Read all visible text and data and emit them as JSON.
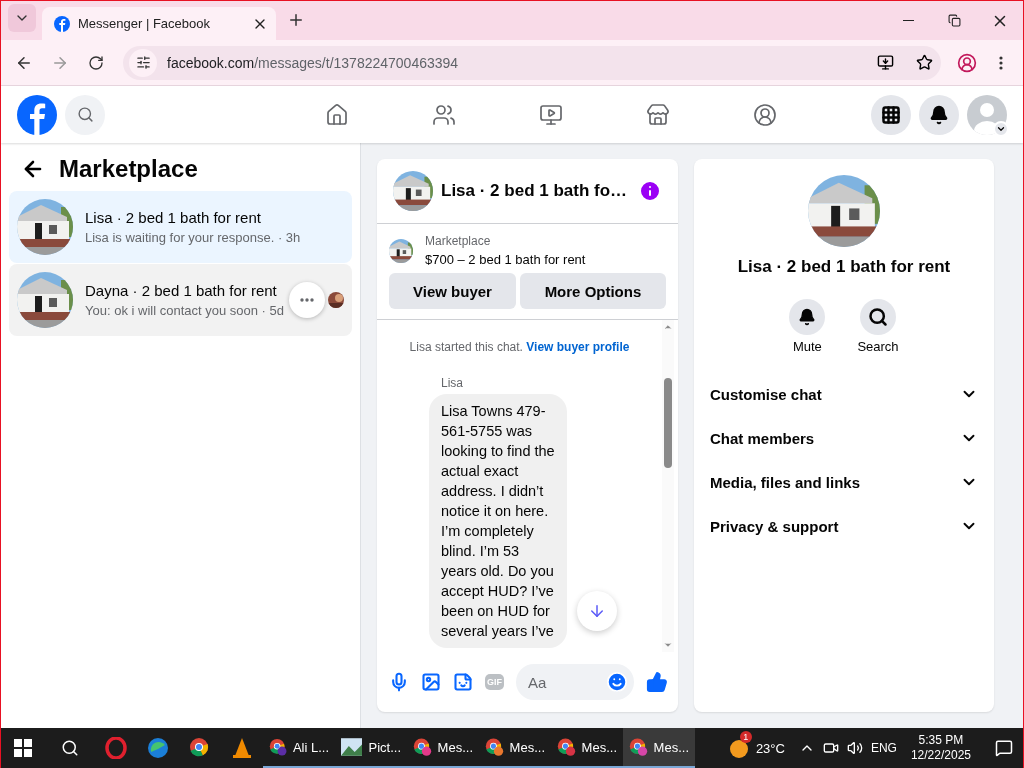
{
  "browser": {
    "tab_title": "Messenger | Facebook",
    "url_host": "facebook.com",
    "url_path": "/messages/t/1378224700463394"
  },
  "left_panel": {
    "title": "Marketplace",
    "conversations": [
      {
        "name": "Lisa · 2 bed 1 bath for rent",
        "meta": "Lisa is waiting for your response. · 3h",
        "selected": true,
        "hovered": false,
        "read_avatar": false
      },
      {
        "name": "Dayna · 2 bed 1 bath for rent",
        "meta": "You: ok i will contact you soon · 5d",
        "selected": false,
        "hovered": true,
        "read_avatar": true
      }
    ]
  },
  "chat": {
    "title": "Lisa · 2 bed 1 bath fo…",
    "listing_source": "Marketplace",
    "listing_title": "$700 – 2 bed 1 bath for rent",
    "buttons": [
      "View buyer",
      "More Options"
    ],
    "system_note": "Lisa started this chat.",
    "system_link": "View buyer profile",
    "sender": "Lisa",
    "message": "Lisa Towns 479-561-5755 was looking to find the actual exact address. I didn’t notice it on here. I’m completely blind. I’m 53 years old. Do you accept HUD? I’ve been on HUD for several years I’ve",
    "composer": {
      "placeholder": "Aa",
      "gif_label": "GIF"
    }
  },
  "info": {
    "title": "Lisa · 2 bed 1 bath for rent",
    "actions": [
      {
        "kind": "bell",
        "label": "Mute"
      },
      {
        "kind": "search",
        "label": "Search"
      }
    ],
    "sections": [
      {
        "label": "Customise chat",
        "expanded": false
      },
      {
        "label": "Chat members",
        "expanded": false
      },
      {
        "label": "Media, files and links",
        "expanded": false
      },
      {
        "label": "Privacy & support",
        "expanded": false
      }
    ]
  },
  "taskbar": {
    "apps": [
      {
        "kind": "opera"
      },
      {
        "kind": "edge"
      },
      {
        "kind": "chrome"
      },
      {
        "kind": "vlc"
      },
      {
        "kind": "chrome-profile",
        "label": "Ali L...",
        "color": "#5b2ea6",
        "selected": false
      },
      {
        "kind": "photos",
        "label": "Pict...",
        "selected": false
      },
      {
        "kind": "chrome-profile",
        "label": "Mes...",
        "color": "#e23a8a",
        "selected": false
      },
      {
        "kind": "chrome-profile",
        "label": "Mes...",
        "color": "#e8772e",
        "selected": false
      },
      {
        "kind": "chrome-profile",
        "label": "Mes...",
        "color": "#d63345",
        "selected": false
      },
      {
        "kind": "chrome-profile",
        "label": "Mes...",
        "color": "#d646a8",
        "selected": true
      }
    ],
    "weather_badge": "1",
    "temperature": "23°C",
    "language": "ENG",
    "time": "5:35 PM",
    "date": "12/22/2025"
  }
}
